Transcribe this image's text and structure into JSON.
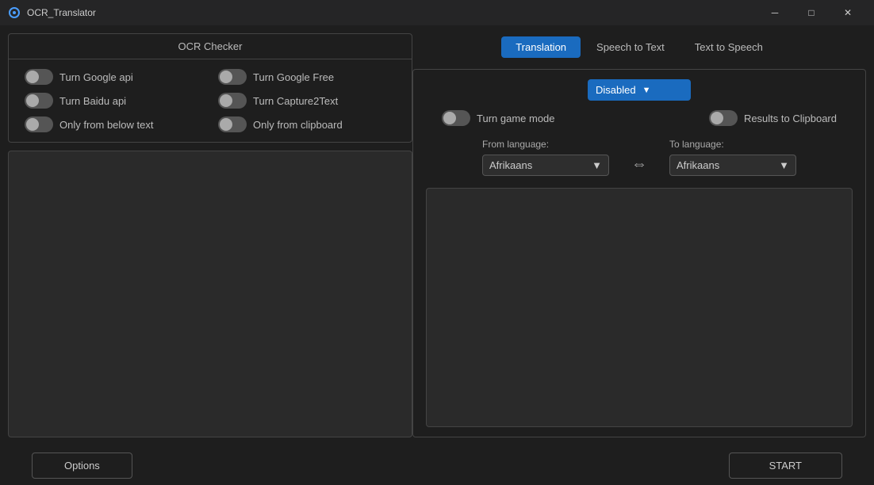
{
  "titlebar": {
    "icon": "🔍",
    "title": "OCR_Translator",
    "minimize_label": "─",
    "maximize_label": "□",
    "close_label": "✕"
  },
  "left": {
    "ocr_checker_title": "OCR Checker",
    "toggles": [
      {
        "id": "google-api",
        "label": "Turn Google api",
        "on": false
      },
      {
        "id": "google-free",
        "label": "Turn Google Free",
        "on": false
      },
      {
        "id": "baidu-api",
        "label": "Turn Baidu api",
        "on": false
      },
      {
        "id": "capture2text",
        "label": "Turn Capture2Text",
        "on": false
      },
      {
        "id": "below-text",
        "label": "Only from below text",
        "on": false
      },
      {
        "id": "clipboard",
        "label": "Only from clipboard",
        "on": false
      }
    ],
    "options_btn": "Options"
  },
  "right": {
    "tabs": [
      {
        "id": "translation",
        "label": "Translation",
        "active": true
      },
      {
        "id": "speech-to-text",
        "label": "Speech to Text",
        "active": false
      },
      {
        "id": "text-to-speech",
        "label": "Text to Speech",
        "active": false
      }
    ],
    "translation_dropdown": {
      "value": "Disabled",
      "arrow": "▼"
    },
    "game_mode_label": "Turn game mode",
    "clipboard_label": "Results to Clipboard",
    "from_language_label": "From language:",
    "to_language_label": "To language:",
    "from_language_value": "Afrikaans",
    "to_language_value": "Afrikaans",
    "swap_icon": "⇔",
    "start_btn": "START"
  },
  "colors": {
    "active_tab_bg": "#1a6bbf",
    "dropdown_bg": "#1a6bbf",
    "background": "#1e1e1e",
    "border": "#444"
  }
}
